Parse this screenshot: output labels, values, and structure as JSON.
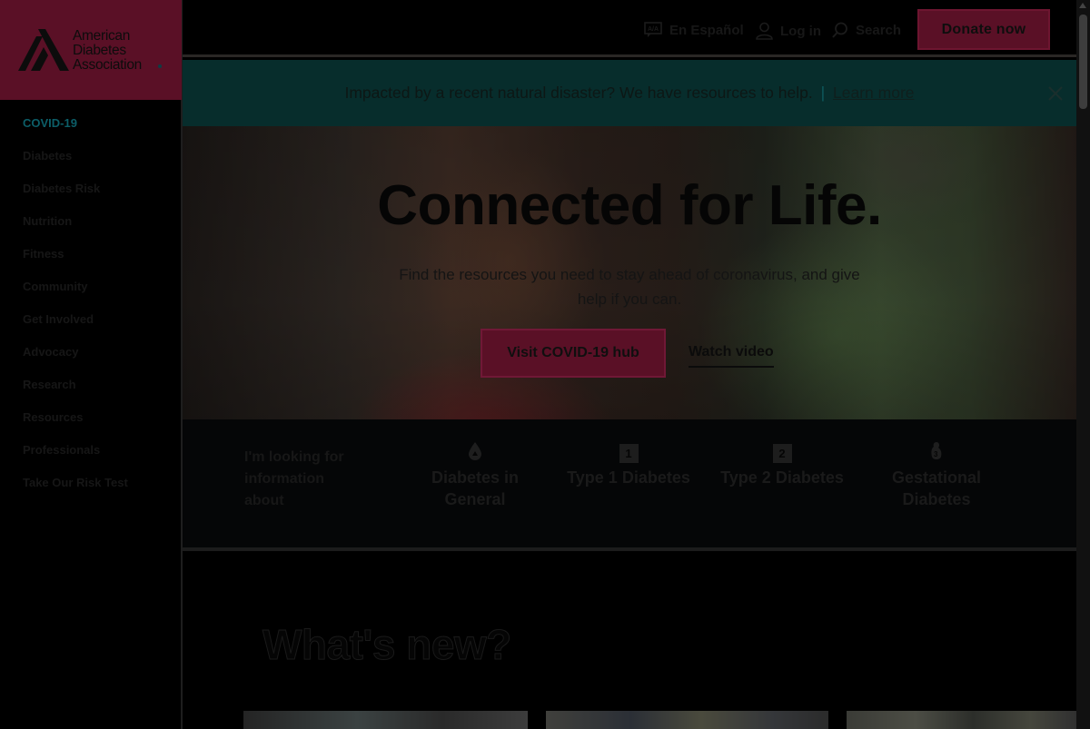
{
  "brand": {
    "name_lines": [
      "American",
      "Diabetes",
      "Association"
    ],
    "brand_color": "#5a1026",
    "accent_color": "#0c5e68"
  },
  "sidebar": {
    "items": [
      {
        "label": "COVID-19",
        "active": true
      },
      {
        "label": "Diabetes"
      },
      {
        "label": "Diabetes Risk"
      },
      {
        "label": "Nutrition"
      },
      {
        "label": "Fitness"
      },
      {
        "label": "Community"
      },
      {
        "label": "Get Involved"
      },
      {
        "label": "Advocacy"
      },
      {
        "label": "Research"
      },
      {
        "label": "Resources"
      },
      {
        "label": "Professionals"
      },
      {
        "label": "Take Our Risk Test"
      }
    ]
  },
  "header": {
    "language_label": "En Español",
    "login_label": "Log in",
    "search_label": "Search",
    "donate_label": "Donate now"
  },
  "alert": {
    "text": "Impacted by a recent natural disaster? We have resources to help.",
    "separator": "|",
    "link_label": "Learn more"
  },
  "hero": {
    "title": "Connected for Life.",
    "subtitle": "Find the resources you need to stay ahead of coronavirus, and give help if you can.",
    "cta_label": "Visit COVID-19 hub",
    "video_label": "Watch video"
  },
  "info": {
    "label": "I'm looking for information about",
    "topics": [
      {
        "icon": "drop-icon",
        "label": "Diabetes in General"
      },
      {
        "icon": "type-1-badge-icon",
        "badge": "1",
        "label": "Type 1 Diabetes"
      },
      {
        "icon": "type-2-badge-icon",
        "badge": "2",
        "label": "Type 2 Diabetes"
      },
      {
        "icon": "gestational-icon",
        "label": "Gestational Diabetes"
      }
    ]
  },
  "whats_new": {
    "title": "What's new?"
  }
}
